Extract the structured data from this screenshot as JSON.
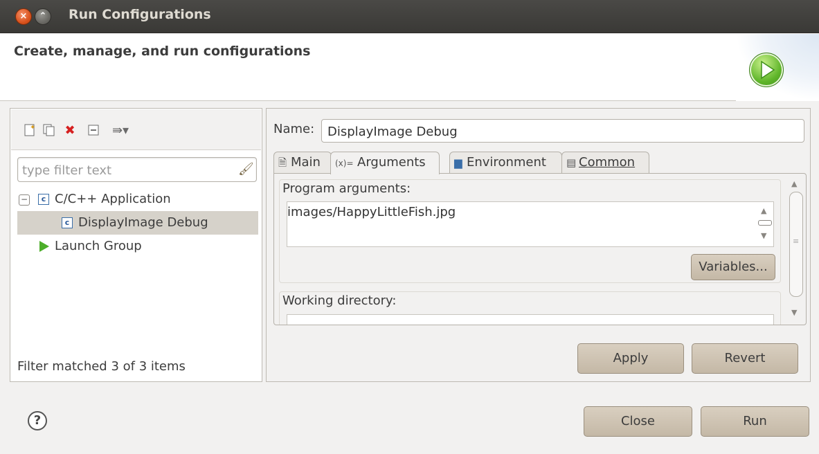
{
  "window": {
    "title": "Run Configurations"
  },
  "header": {
    "title": "Create, manage, and run configurations"
  },
  "left_panel": {
    "toolbar": [
      {
        "name": "new-configuration-icon",
        "glyph": "✧"
      },
      {
        "name": "duplicate-icon",
        "glyph": "⎘"
      },
      {
        "name": "delete-icon",
        "glyph": "✖"
      },
      {
        "name": "collapse-all-icon",
        "glyph": "⊟"
      },
      {
        "name": "filter-icon",
        "glyph": "⇛"
      }
    ],
    "filter": {
      "placeholder": "type filter text",
      "value": ""
    },
    "tree": {
      "cpp_app": "C/C++ Application",
      "display_debug": "DisplayImage Debug",
      "launch_group": "Launch Group"
    },
    "status": "Filter matched 3 of 3 items"
  },
  "right_panel": {
    "name_label": "Name:",
    "name_value": "DisplayImage Debug",
    "tabs": {
      "main": "Main",
      "arguments": "Arguments",
      "environment": "Environment",
      "common": "Common"
    },
    "active_tab": "Arguments",
    "program_arguments_label": "Program arguments:",
    "program_arguments_value": "images/HappyLittleFish.jpg",
    "variables_button": "Variables...",
    "working_directory_label": "Working directory:",
    "apply_button": "Apply",
    "revert_button": "Revert"
  },
  "footer": {
    "close_button": "Close",
    "run_button": "Run"
  },
  "colors": {
    "titlebar": "#3c3b37",
    "button": "#cdc3b3",
    "selection": "#d6d2ca",
    "run_icon": "#5fb52a"
  }
}
